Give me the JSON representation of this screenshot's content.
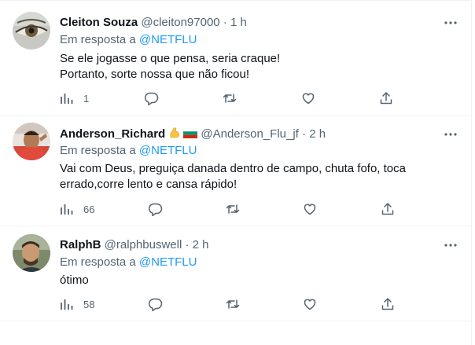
{
  "tweets": [
    {
      "name": "Cleiton Souza",
      "handle": "@cleiton97000",
      "dot": "·",
      "time": "1 h",
      "reply_prefix": "Em resposta a",
      "reply_mention": "@NETFLU",
      "text_lines": [
        "Se ele jogasse o que pensa, seria craque!",
        "Portanto, sorte nossa que não ficou!"
      ],
      "views": "1"
    },
    {
      "name": "Anderson_Richard",
      "emojis": [
        "flexed-biceps",
        "bulgaria-flag"
      ],
      "handle": "@Anderson_Flu_jf",
      "dot": "·",
      "time": "2 h",
      "reply_prefix": "Em resposta a",
      "reply_mention": "@NETFLU",
      "text_lines": [
        "Vai com Deus, preguiça danada dentro de campo, chuta fofo, toca",
        "errado,corre lento e cansa rápido!"
      ],
      "views": "66"
    },
    {
      "name": "RalphB",
      "handle": "@ralphbuswell",
      "dot": "·",
      "time": "2 h",
      "reply_prefix": "Em resposta a",
      "reply_mention": "@NETFLU",
      "text_lines": [
        "ótimo"
      ],
      "views": "58"
    }
  ],
  "icons": {
    "views": "bar-chart-icon",
    "reply": "reply-bubble-icon",
    "retweet": "retweet-icon",
    "like": "heart-icon",
    "share": "share-icon",
    "more": "more-dots-icon"
  },
  "colors": {
    "text": "#0f1419",
    "secondary": "#536471",
    "link": "#1d9bf0",
    "border": "#eff3f4"
  }
}
